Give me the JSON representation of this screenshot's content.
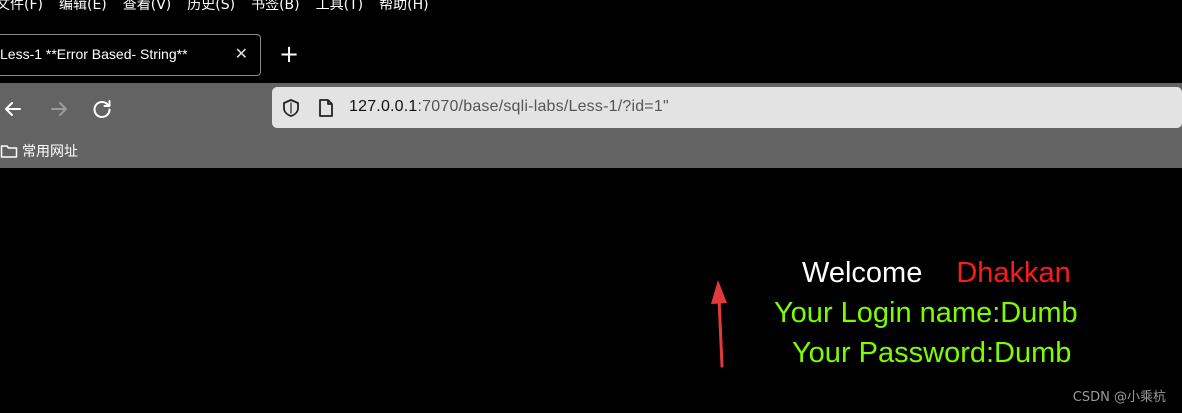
{
  "menu": [
    "文件(F)",
    "编辑(E)",
    "查看(V)",
    "历史(S)",
    "书签(B)",
    "工具(T)",
    "帮助(H)"
  ],
  "tab": {
    "title": "Less-1 **Error Based- String**",
    "close": "✕"
  },
  "new_tab": "+",
  "url": {
    "host": "127.0.0.1",
    "rest": ":7070/base/sqli-labs/Less-1/?id=1\""
  },
  "bookmark": {
    "label": "常用网址"
  },
  "page": {
    "welcome": "Welcome",
    "name": "Dhakkan",
    "login": "Your Login name:Dumb",
    "password": "Your Password:Dumb"
  },
  "watermark": "CSDN @小乘杭",
  "colors": {
    "welcome": "#ffffff",
    "name": "#ff1a1a",
    "info": "#7cfc00",
    "arrow": "#e03a3a"
  }
}
